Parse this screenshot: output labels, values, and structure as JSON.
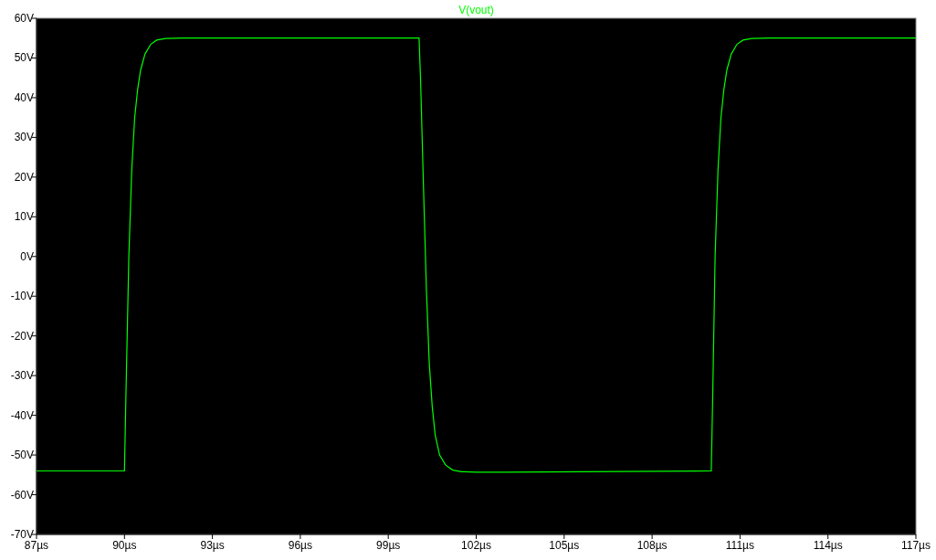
{
  "chart_data": {
    "type": "line",
    "x": [
      87,
      90,
      90.05,
      90.15,
      90.25,
      90.35,
      90.45,
      90.55,
      90.7,
      90.9,
      91.1,
      91.4,
      92,
      93,
      100.05,
      100.1,
      100.2,
      100.3,
      100.4,
      100.5,
      100.6,
      100.75,
      100.95,
      101.2,
      101.5,
      102,
      103,
      110.02,
      110.07,
      110.15,
      110.25,
      110.35,
      110.45,
      110.55,
      110.7,
      110.9,
      111.1,
      111.4,
      112,
      117
    ],
    "series": [
      {
        "name": "V(vout)",
        "color": "#00ff00",
        "values": [
          -54,
          -54,
          -35,
          0,
          22,
          35,
          42,
          47,
          51,
          53.5,
          54.5,
          54.9,
          55,
          55,
          55,
          45,
          18,
          -8,
          -27,
          -38,
          -45,
          -50,
          -52.5,
          -53.8,
          -54.2,
          -54.3,
          -54.3,
          -54,
          -35,
          0,
          22,
          35,
          42,
          47,
          51,
          53.5,
          54.5,
          54.9,
          55,
          55
        ]
      }
    ],
    "xlim": [
      87,
      117
    ],
    "ylim": [
      -70,
      60
    ],
    "xticks": [
      {
        "value": 87,
        "label": "87µs"
      },
      {
        "value": 90,
        "label": "90µs"
      },
      {
        "value": 93,
        "label": "93µs"
      },
      {
        "value": 96,
        "label": "96µs"
      },
      {
        "value": 99,
        "label": "99µs"
      },
      {
        "value": 102,
        "label": "102µs"
      },
      {
        "value": 105,
        "label": "105µs"
      },
      {
        "value": 108,
        "label": "108µs"
      },
      {
        "value": 111,
        "label": "111µs"
      },
      {
        "value": 114,
        "label": "114µs"
      },
      {
        "value": 117,
        "label": "117µs"
      }
    ],
    "yticks": [
      {
        "value": 60,
        "label": "60V"
      },
      {
        "value": 50,
        "label": "50V"
      },
      {
        "value": 40,
        "label": "40V"
      },
      {
        "value": 30,
        "label": "30V"
      },
      {
        "value": 20,
        "label": "20V"
      },
      {
        "value": 10,
        "label": "10V"
      },
      {
        "value": 0,
        "label": "0V"
      },
      {
        "value": -10,
        "label": "-10V"
      },
      {
        "value": -20,
        "label": "-20V"
      },
      {
        "value": -30,
        "label": "-30V"
      },
      {
        "value": -40,
        "label": "-40V"
      },
      {
        "value": -50,
        "label": "-50V"
      },
      {
        "value": -60,
        "label": "-60V"
      },
      {
        "value": -70,
        "label": "-70V"
      }
    ]
  }
}
